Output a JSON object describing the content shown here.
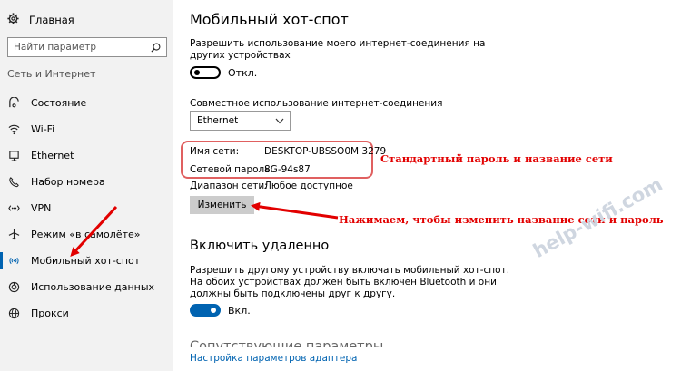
{
  "sidebar": {
    "home_label": "Главная",
    "search_placeholder": "Найти параметр",
    "section_label": "Сеть и Интернет",
    "items": [
      {
        "label": "Состояние",
        "icon": "status-icon"
      },
      {
        "label": "Wi-Fi",
        "icon": "wifi-icon"
      },
      {
        "label": "Ethernet",
        "icon": "ethernet-icon"
      },
      {
        "label": "Набор номера",
        "icon": "dialup-icon"
      },
      {
        "label": "VPN",
        "icon": "vpn-icon"
      },
      {
        "label": "Режим «в самолёте»",
        "icon": "airplane-icon"
      },
      {
        "label": "Мобильный хот-спот",
        "icon": "hotspot-icon"
      },
      {
        "label": "Использование данных",
        "icon": "data-usage-icon"
      },
      {
        "label": "Прокси",
        "icon": "globe-icon"
      }
    ],
    "active_index": 6
  },
  "main": {
    "title": "Мобильный хот-спот",
    "share_desc_line1": "Разрешить использование моего интернет-соединения на",
    "share_desc_line2": "других устройствах",
    "share_toggle_label": "Откл.",
    "share_toggle_on": false,
    "connection_label": "Совместное использование интернет-соединения",
    "connection_value": "Ethernet",
    "network_name_label": "Имя сети:",
    "network_name_value": "DESKTOP-UBSSO0M 3279",
    "password_label": "Сетевой пароль:",
    "password_value": "8G-94s87",
    "band_label": "Диапазон сети:",
    "band_value": "Любое доступное",
    "edit_button": "Изменить",
    "remote_title": "Включить удаленно",
    "remote_desc_line1": "Разрешить другому устройству включать мобильный хот-спот.",
    "remote_desc_line2": "На обоих устройствах должен быть включен Bluetooth и они",
    "remote_desc_line3": "должны быть подключены друг к другу.",
    "remote_toggle_label": "Вкл.",
    "remote_toggle_on": true,
    "related_title": "Сопутствующие параметры",
    "adapter_link": "Настройка параметров адаптера"
  },
  "annotations": {
    "default_credentials": "Стандартный пароль и название сети",
    "click_to_change": "Нажимаем, чтобы изменить название сети и пароль",
    "watermark": "help-wifi.com"
  },
  "colors": {
    "accent": "#0063b1",
    "annotation": "#e20000",
    "sidebar_bg": "#f2f2f2"
  }
}
